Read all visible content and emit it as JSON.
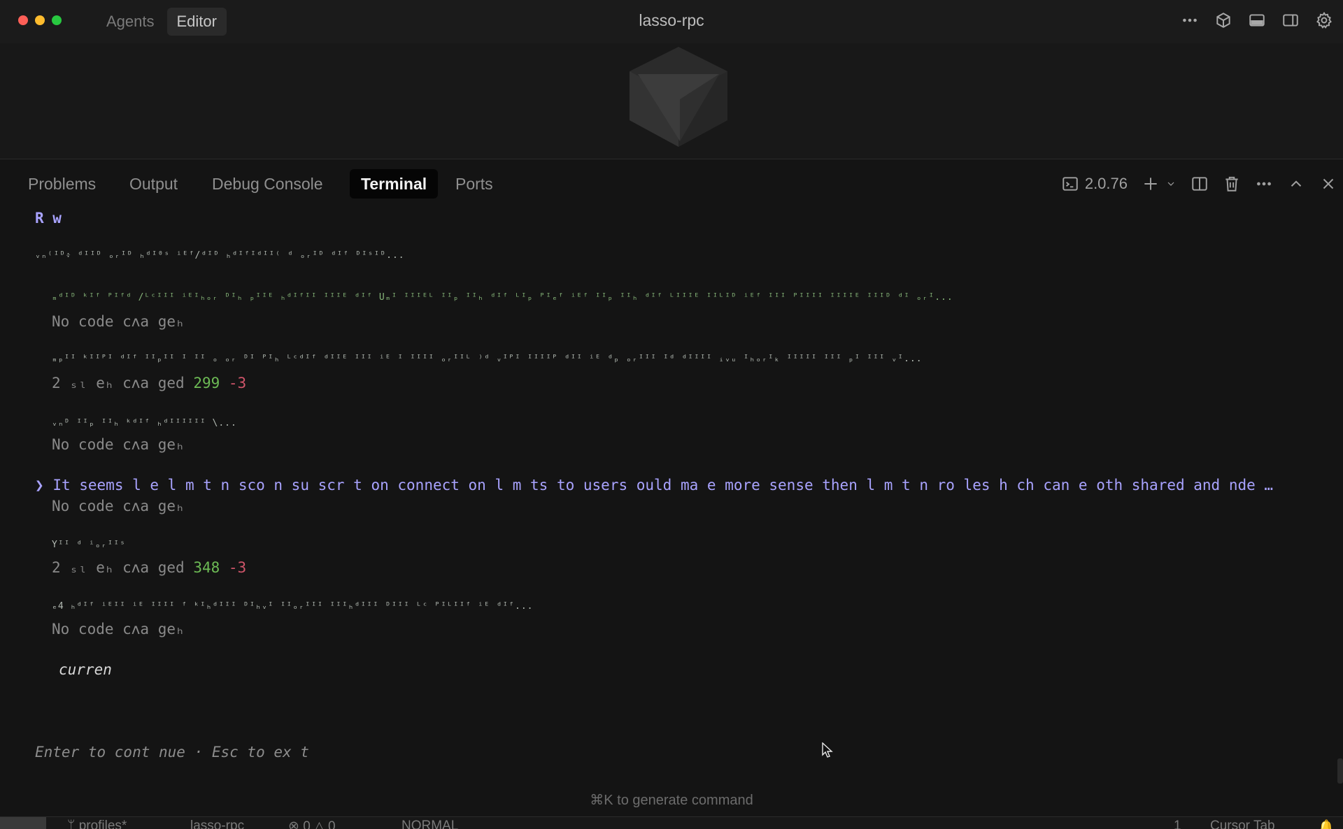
{
  "window": {
    "title": "lasso-rpc",
    "mode_tabs": [
      "Agents",
      "Editor"
    ],
    "active_mode": "Editor"
  },
  "panel": {
    "tabs": [
      "Problems",
      "Output",
      "Debug Console",
      "Terminal",
      "Ports"
    ],
    "active_tab": "Terminal",
    "version": "2.0.76"
  },
  "terminal": {
    "header": "R w",
    "lines": {
      "l1_garble": "ᵥₙ⁽ᴵᴰ፥ ᵈᴵᴵᴰ ₒᵣᴵᴰ ₕᵈᴵ⁰ˢ ⁱᴱᶠ/ᵈᴵᴰ ₕᵈᴵᶠᴵᵈᴵᴵ⁽ ᵈ ₒᵣᴵᴰ ᵈᴵᶠ ᴰᴵˢᴵᴰ...",
      "l2_garble": "ₘᵈᴵᴰ ᵏᴵᶠ ᴾᴵᶠᵈ /ᴸᶜᴵᴵᴵ ⁱᴱᴵₕₒᵣ ᴰᴵₕ ₚᴵᴵᴱ ₕᵈᴵᶠᴵᴵ ᴵᴵᴵᴱ ᵈᴵᶠ Uₘᴵ ᴵᴵᴵᴱᴸ ᴵᴵₚ ᴵᴵₕ ᵈᴵᶠ ᴸᴵₚ ᴾᴵₑᶠ ⁱᴱᶠ ᴵᴵₚ ᴵᴵₕ ᵈᴵᶠ ᴸᴵᴵᴵᴱ ᴵᴵᴸᴵᴰ ⁱᴱᶠ ᴵᴵᴵ ᴾᴵᴵᴵᴵ ᴵᴵᴵᴵᴱ ᴵᴵᴵᴰ ᵈᴵ ₒᵣᴵ...",
      "l2_status": "No code cʌa geₕ",
      "l3_garble": "ₘₚᴵᴵ ᵏᴵᴵᴾᴵ ᵈᴵᶠ ᴵᴵₚᴵᴵ ᴵ ᴵᴵ ₒ ₒᵣ ᴰᴵ ᴾᴵₕ ᴸᶜᵈᴵᶠ ᵈᴵᴵᴱ ᴵᴵᴵ ⁱᴱ ᴵ ᴵᴵᴵᴵ ₒᵣᴵᴵᴸ ⁾ᵈ ᵥᴵᴾᴵ ᴵᴵᴵᴵᴾ ᵈᴵᴵ ⁱᴱ ᵈₚ ₒᵣᴵᴵᴵ ᴵᵈ ᵈᴵᴵᴵᴵ ᵢᵥᵤ ᴵₕₒᵣᴵₖ ᴵᴵᴵᴵᴵ ᴵᴵᴵ ₚᴵ ᴵᴵᴵ ᵥᴵ...",
      "l3_status_prefix": "2 ₛₗ eₕ cʌa ged",
      "l3_add": "299",
      "l3_del": "-3",
      "l4_garble": "ᵥₙᴰ ᴵᴵₚ ᴵᴵₕ ᵏᵈᴵᶠ ₕᵈᴵᴵᴵᴵᴵᴵ \\...",
      "l4_status": "No code cʌa geₕ",
      "prompt_symbol": "❯",
      "prompt_text": "It seems l  e l m t n  sco  n  su scr  t on connect on l m ts to users  ould ma e more sense then l m t n      ro  les   h ch can  e  oth shared and  nde …",
      "prompt_status": "No code cʌa geₕ",
      "l6_garble": "Yᴵᴵ ᵈ ⁱₒᵣᴵᴵˢ",
      "l6_status_prefix": "2 ₛₗ eₕ cʌa ged",
      "l6_add": "348",
      "l6_del": "-3",
      "l7_garble": "ₑ4 ₕᵈᴵᶠ ⁱᴱᴵᴵ ⁱᴱ ᴵᴵᴵᴵ ᶠ ᵏᴵₕᵈᴵᴵᴵ ᴰᴵₕᵥᴵ ᴵᴵₒᵣᴵᴵᴵ ᴵᴵᴵₕᵈᴵᴵᴵ ᴰᴵᴵᴵ ᴸᶜ ᴾᴵᴸᴵᴵᶠ ⁱᴱ ᵈᴵᶠ...",
      "l7_status": "No code cʌa geₕ",
      "current": "curren"
    },
    "hint": "Enter to cont nue · Esc to ex t"
  },
  "footer": {
    "generate_command": "⌘K to generate command"
  },
  "statusbar": {
    "branch": "profiles*",
    "workspace": "lasso-rpc",
    "errors": "0",
    "warnings": "0",
    "mode": "NORMAL",
    "line": "1",
    "cursor_tab": "Cursor Tab"
  },
  "colors": {
    "prompt": "#a9a3ff",
    "additions": "#6dbb55",
    "deletions": "#d0556a"
  }
}
